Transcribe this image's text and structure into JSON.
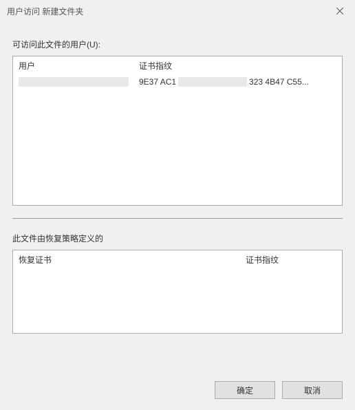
{
  "titlebar": {
    "title": "用户访问 新建文件夹"
  },
  "labels": {
    "users_with_access": "可访问此文件的用户(U):",
    "recovery_policy": "此文件由恢复策略定义的"
  },
  "users_table": {
    "headers": {
      "user": "用户",
      "thumbprint": "证书指纹"
    },
    "rows": [
      {
        "thumbprint_part1": "9E37 AC1",
        "thumbprint_part2": "323 4B47 C55..."
      }
    ]
  },
  "recovery_table": {
    "headers": {
      "recovery_cert": "恢复证书",
      "thumbprint": "证书指纹"
    }
  },
  "buttons": {
    "ok": "确定",
    "cancel": "取消"
  }
}
